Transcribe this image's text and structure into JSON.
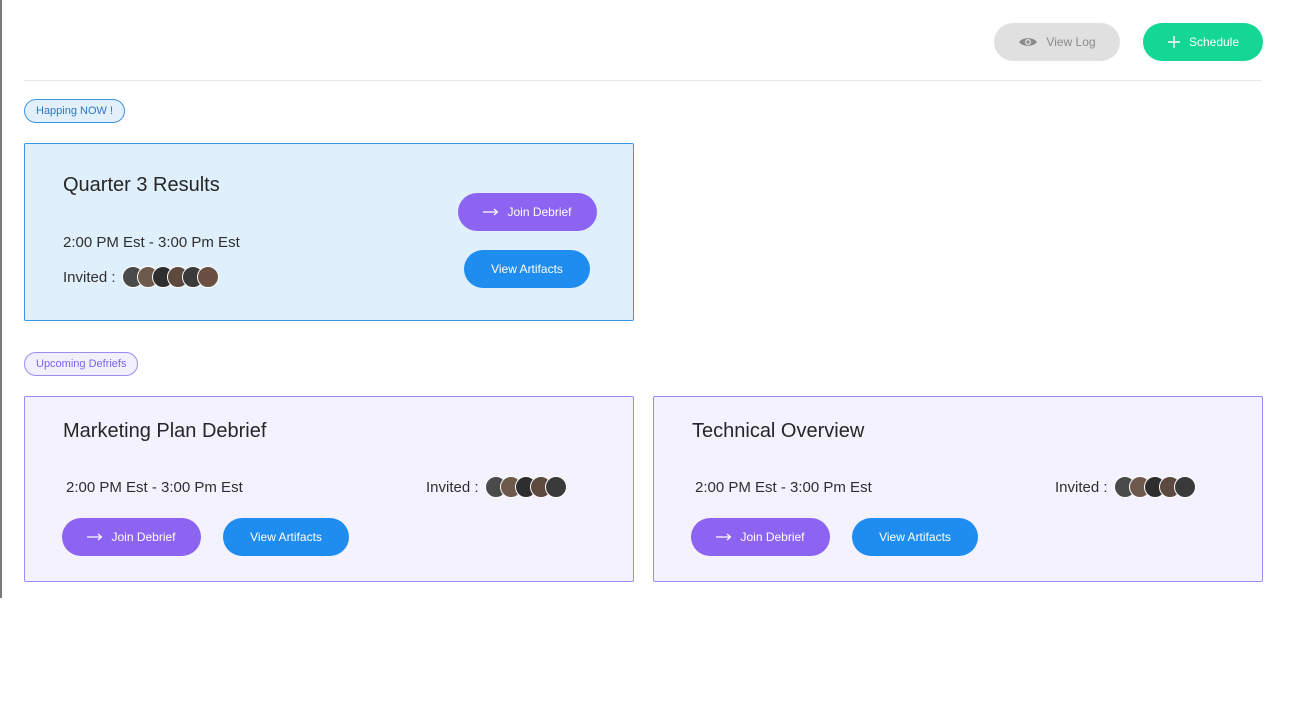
{
  "header": {
    "view_log_label": "View Log",
    "schedule_label": "Schedule"
  },
  "sections": {
    "now_label": "Happing NOW !",
    "upcoming_label": "Upcoming Defriefs"
  },
  "now_card": {
    "title": "Quarter 3 Results",
    "time": "2:00 PM Est - 3:00 Pm Est",
    "invited_label": "Invited :",
    "join_label": "Join Debrief",
    "artifacts_label": "View Artifacts"
  },
  "upcoming": [
    {
      "title": "Marketing Plan Debrief",
      "time": "2:00 PM Est - 3:00 Pm Est",
      "invited_label": "Invited :",
      "join_label": "Join Debrief",
      "artifacts_label": "View Artifacts"
    },
    {
      "title": "Technical Overview",
      "time": "2:00 PM Est - 3:00 Pm Est",
      "invited_label": "Invited :",
      "join_label": "Join Debrief",
      "artifacts_label": "View Artifacts"
    }
  ],
  "icons": {
    "view_log": "eye-icon",
    "schedule": "plus-icon",
    "join": "arrow-right-icon"
  },
  "colors": {
    "schedule_green": "#14d695",
    "join_purple": "#8d63f2",
    "artifacts_blue": "#1f8cf0",
    "now_card_bg": "#dff0fc",
    "upcoming_card_bg": "#f4f2ff"
  }
}
